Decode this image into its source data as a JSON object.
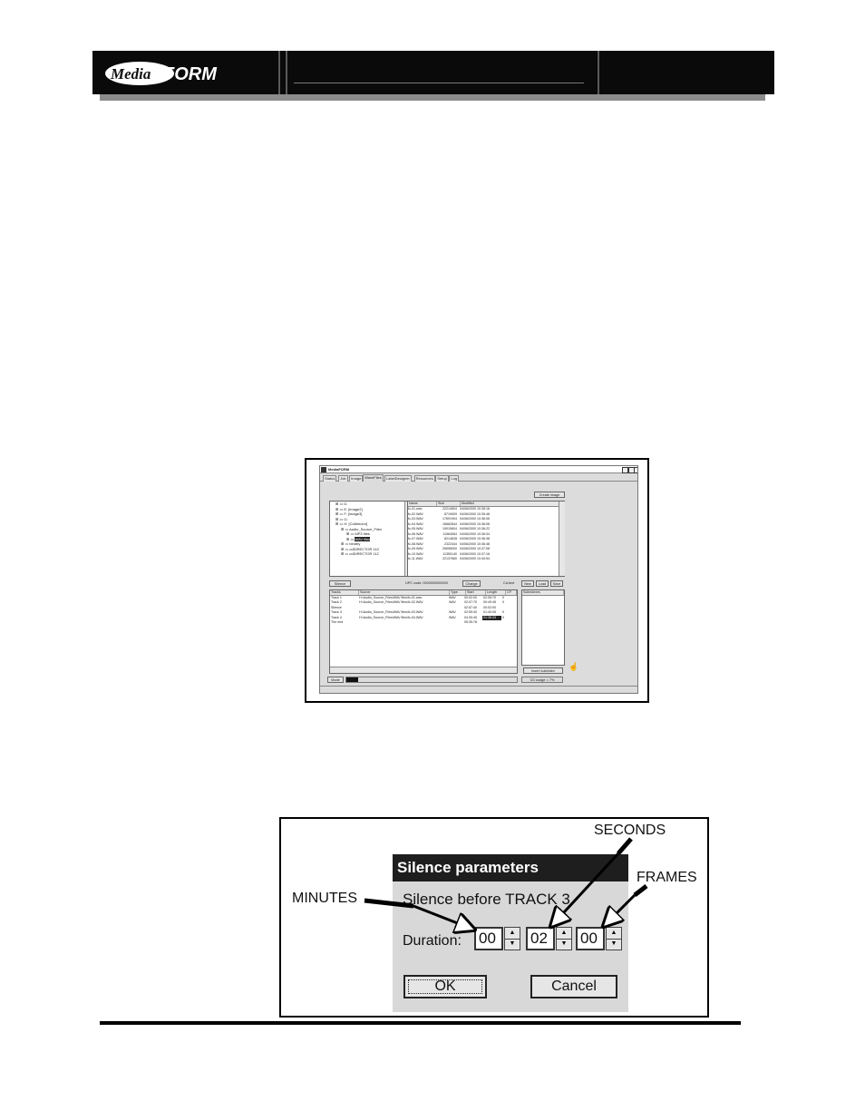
{
  "header": {
    "logo_prefix": "Media",
    "logo_suffix": "FORM"
  },
  "app_window": {
    "title": "MediaFORM",
    "tabs": [
      "Status",
      "Job",
      "Image",
      "WaveFiles",
      "LabelDesigner",
      "Resources",
      "Setup",
      "Log"
    ],
    "active_tab": "WaveFiles",
    "create_image_label": "Create image",
    "tree": [
      {
        "indent": 1,
        "label": "D:"
      },
      {
        "indent": 1,
        "label": "E: [image2]"
      },
      {
        "indent": 1,
        "label": "F: [image3]"
      },
      {
        "indent": 1,
        "label": "G:"
      },
      {
        "indent": 1,
        "label": "H: [Cddirector]"
      },
      {
        "indent": 2,
        "label": "Audio_Source_Files"
      },
      {
        "indent": 3,
        "label": "MP3 files"
      },
      {
        "indent": 3,
        "label": "WAV files"
      },
      {
        "indent": 2,
        "label": "bindtry"
      },
      {
        "indent": 2,
        "label": "cdDIRECTOR 110"
      },
      {
        "indent": 2,
        "label": "cdDIRECTOR 112"
      }
    ],
    "file_columns": [
      "Name",
      "Size",
      "Modified"
    ],
    "files": [
      [
        "fc-01.wav",
        "22214604",
        "04/06/2000 10:35:16"
      ],
      [
        "fc-02.WAV",
        "8719009",
        "04/06/2000 10:35:48"
      ],
      [
        "fc-03.WAV",
        "17691904",
        "04/06/2000 10:36:06"
      ],
      [
        "fc-04.WAV",
        "16662844",
        "04/06/2000 10:36:08"
      ],
      [
        "fc-05.WAV",
        "19015604",
        "04/06/2000 10:36:22"
      ],
      [
        "fc-06.WAV",
        "11564064",
        "04/06/2000 10:36:34"
      ],
      [
        "fc-07.WAV",
        "8214628",
        "04/06/2000 10:36:38"
      ],
      [
        "fc-08.WAV",
        "2322444",
        "04/06/2000 10:36:48"
      ],
      [
        "fc-09.WAV",
        "26596000",
        "04/06/2000 10:37:08"
      ],
      [
        "fc-10.WAV",
        "11350140",
        "04/06/2000 10:37:16"
      ],
      [
        "fc-11.WAV",
        "22137660",
        "04/06/2000 10:40:54"
      ]
    ],
    "silence_button": "Silence",
    "upc_label": "UPC code: 0000000000000",
    "change_button": "Change",
    "cd_text_label": "Cd-text",
    "new_button": "New",
    "load_button": "Load",
    "save_button": "Save",
    "track_columns": [
      "Tracks",
      "Source",
      "Type",
      "Start",
      "Length",
      "CP"
    ],
    "tracks": [
      [
        "Track 1",
        "H:\\Audio_Source_Files\\WAV files\\fc-01.wav",
        "WAV",
        "00:02:00",
        "02:05:70",
        "0"
      ],
      [
        "Track 2",
        "H:\\Audio_Source_Files\\WAV files\\fc-02.WAV",
        "WAV",
        "02:07:70",
        "00:49:45",
        "0"
      ],
      [
        "Silence",
        "",
        "",
        "02:57:40",
        "00:02:00",
        ""
      ],
      [
        "Track 3",
        "H:\\Audio_Source_Files\\WAV files\\fc-03.WAV",
        "WAV",
        "02:59:40",
        "01:40:05",
        "0"
      ],
      [
        "Track 4",
        "H:\\Audio_Source_Files\\WAV files\\fc-04.WAV",
        "WAV",
        "04:39:45",
        "01:36:33",
        "0"
      ],
      [
        "The end",
        "",
        "",
        "05:35:78",
        "",
        ""
      ]
    ],
    "subindex_header": "Subindexes",
    "insert_subindex_button": "Insert subindex",
    "status_left": "Mode",
    "status_right": "CD usage = 7%"
  },
  "silence_dialog": {
    "title": "Silence parameters",
    "message": "Silence before TRACK 3",
    "duration_label": "Duration:",
    "minutes": "00",
    "seconds": "02",
    "frames": "00",
    "ok_label": "OK",
    "cancel_label": "Cancel"
  },
  "callouts": {
    "minutes": "MINUTES",
    "seconds": "SECONDS",
    "frames": "FRAMES"
  }
}
